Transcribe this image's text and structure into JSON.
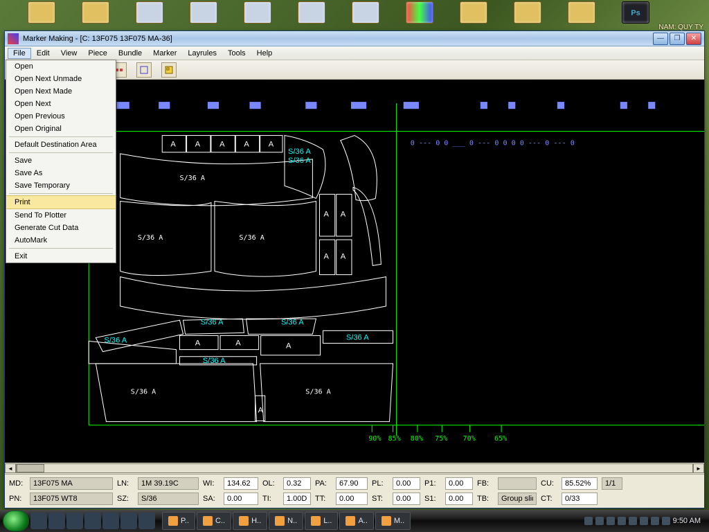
{
  "window": {
    "title": "Marker Making - [C:   13F075   13F075 MA-36]"
  },
  "menus": [
    "File",
    "Edit",
    "View",
    "Piece",
    "Bundle",
    "Marker",
    "Layrules",
    "Tools",
    "Help"
  ],
  "file_menu": {
    "groups": [
      [
        "Open",
        "Open Next Unmade",
        "Open Next Made",
        "Open Next",
        "Open Previous",
        "Open Original"
      ],
      [
        "Default Destination Area"
      ],
      [
        "Save",
        "Save As",
        "Save Temporary"
      ],
      [
        "Print",
        "Send To Plotter",
        "Generate Cut Data",
        "AutoMark"
      ],
      [
        "Exit"
      ]
    ],
    "highlighted": "Print"
  },
  "status": {
    "row1": {
      "MD": "13F075 MA",
      "LN": "1M 39.19C",
      "WI": "134.62",
      "OL": "0.32",
      "PA": "67.90",
      "PL": "0.00",
      "P1": "0.00",
      "FB": "",
      "CU": "85.52%",
      "CU2": "1/1"
    },
    "row2": {
      "PN": "13F075 WT8",
      "SZ": "S/36",
      "SA": "0.00",
      "TI": "1.00D",
      "TT": "0.00",
      "ST": "0.00",
      "S1": "0.00",
      "TB": "Group slide",
      "CT": "0/33"
    }
  },
  "canvas": {
    "big_labels": [
      "S/36 A",
      "S/36 A",
      "S/36 A",
      "S/36 A",
      "S/36 A",
      "S/36 A"
    ],
    "small_A": "A",
    "cyan": "S/36 A",
    "top_zeros": "0 --- 0  0 ___  0 --- 0  0  0  0 ---  0 --- 0",
    "percents": [
      "90%",
      "85%",
      "80%",
      "75%",
      "70%",
      "65%"
    ]
  },
  "desk_apps": [
    "folder",
    "folder",
    "printer",
    "printer",
    "printer",
    "printer",
    "printer",
    "colors",
    "folder",
    "folder",
    "folder",
    "ps"
  ],
  "tasks": [
    "P..",
    "C..",
    "H..",
    "N..",
    "L..",
    "A..",
    "M.."
  ],
  "tray_time": "9:50 AM",
  "stamp": "NAM: QUY TY"
}
